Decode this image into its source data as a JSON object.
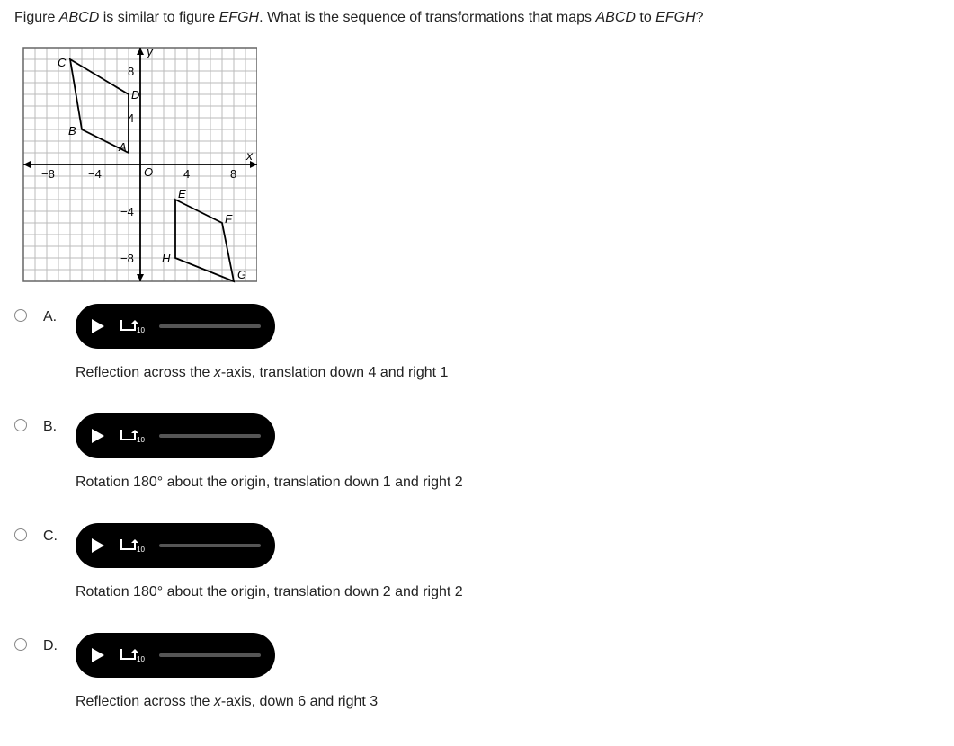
{
  "question": {
    "pre1": "Figure ",
    "it1": "ABCD",
    "mid1": " is similar to figure ",
    "it2": "EFGH",
    "mid2": ". What is the sequence of transformations that maps ",
    "it3": "ABCD",
    "mid3": " to ",
    "it4": "EFGH",
    "end": "?"
  },
  "chart_data": {
    "type": "coordinate_plane",
    "xrange": [
      -10,
      10
    ],
    "yrange": [
      -11,
      10
    ],
    "xticks": [
      -8,
      -4,
      4,
      8
    ],
    "yticks": [
      -8,
      -4,
      4,
      8
    ],
    "xlabel": "x",
    "ylabel": "y",
    "origin_label": "O",
    "shapes": [
      {
        "name": "ABCD",
        "labeled_points": {
          "A": [
            -1,
            1
          ],
          "B": [
            -5,
            3
          ],
          "C": [
            -6,
            9
          ],
          "D": [
            -1,
            6
          ]
        }
      },
      {
        "name": "EFGH",
        "labeled_points": {
          "E": [
            3,
            -3
          ],
          "F": [
            7,
            -5
          ],
          "G": [
            8,
            -11
          ],
          "H": [
            3,
            -8
          ]
        }
      }
    ]
  },
  "options": {
    "A": {
      "letter": "A.",
      "pre": "Reflection across the ",
      "ital": "x",
      "post": "-axis, translation down 4 and right 1"
    },
    "B": {
      "letter": "B.",
      "full": "Rotation 180° about the origin, translation down 1 and right 2"
    },
    "C": {
      "letter": "C.",
      "full": "Rotation 180° about the origin, translation down 2 and right 2"
    },
    "D": {
      "letter": "D.",
      "pre": "Reflection across the ",
      "ital": "x",
      "post": "-axis, down 6 and right 3"
    }
  },
  "audio": {
    "rewind_amount": "10"
  }
}
